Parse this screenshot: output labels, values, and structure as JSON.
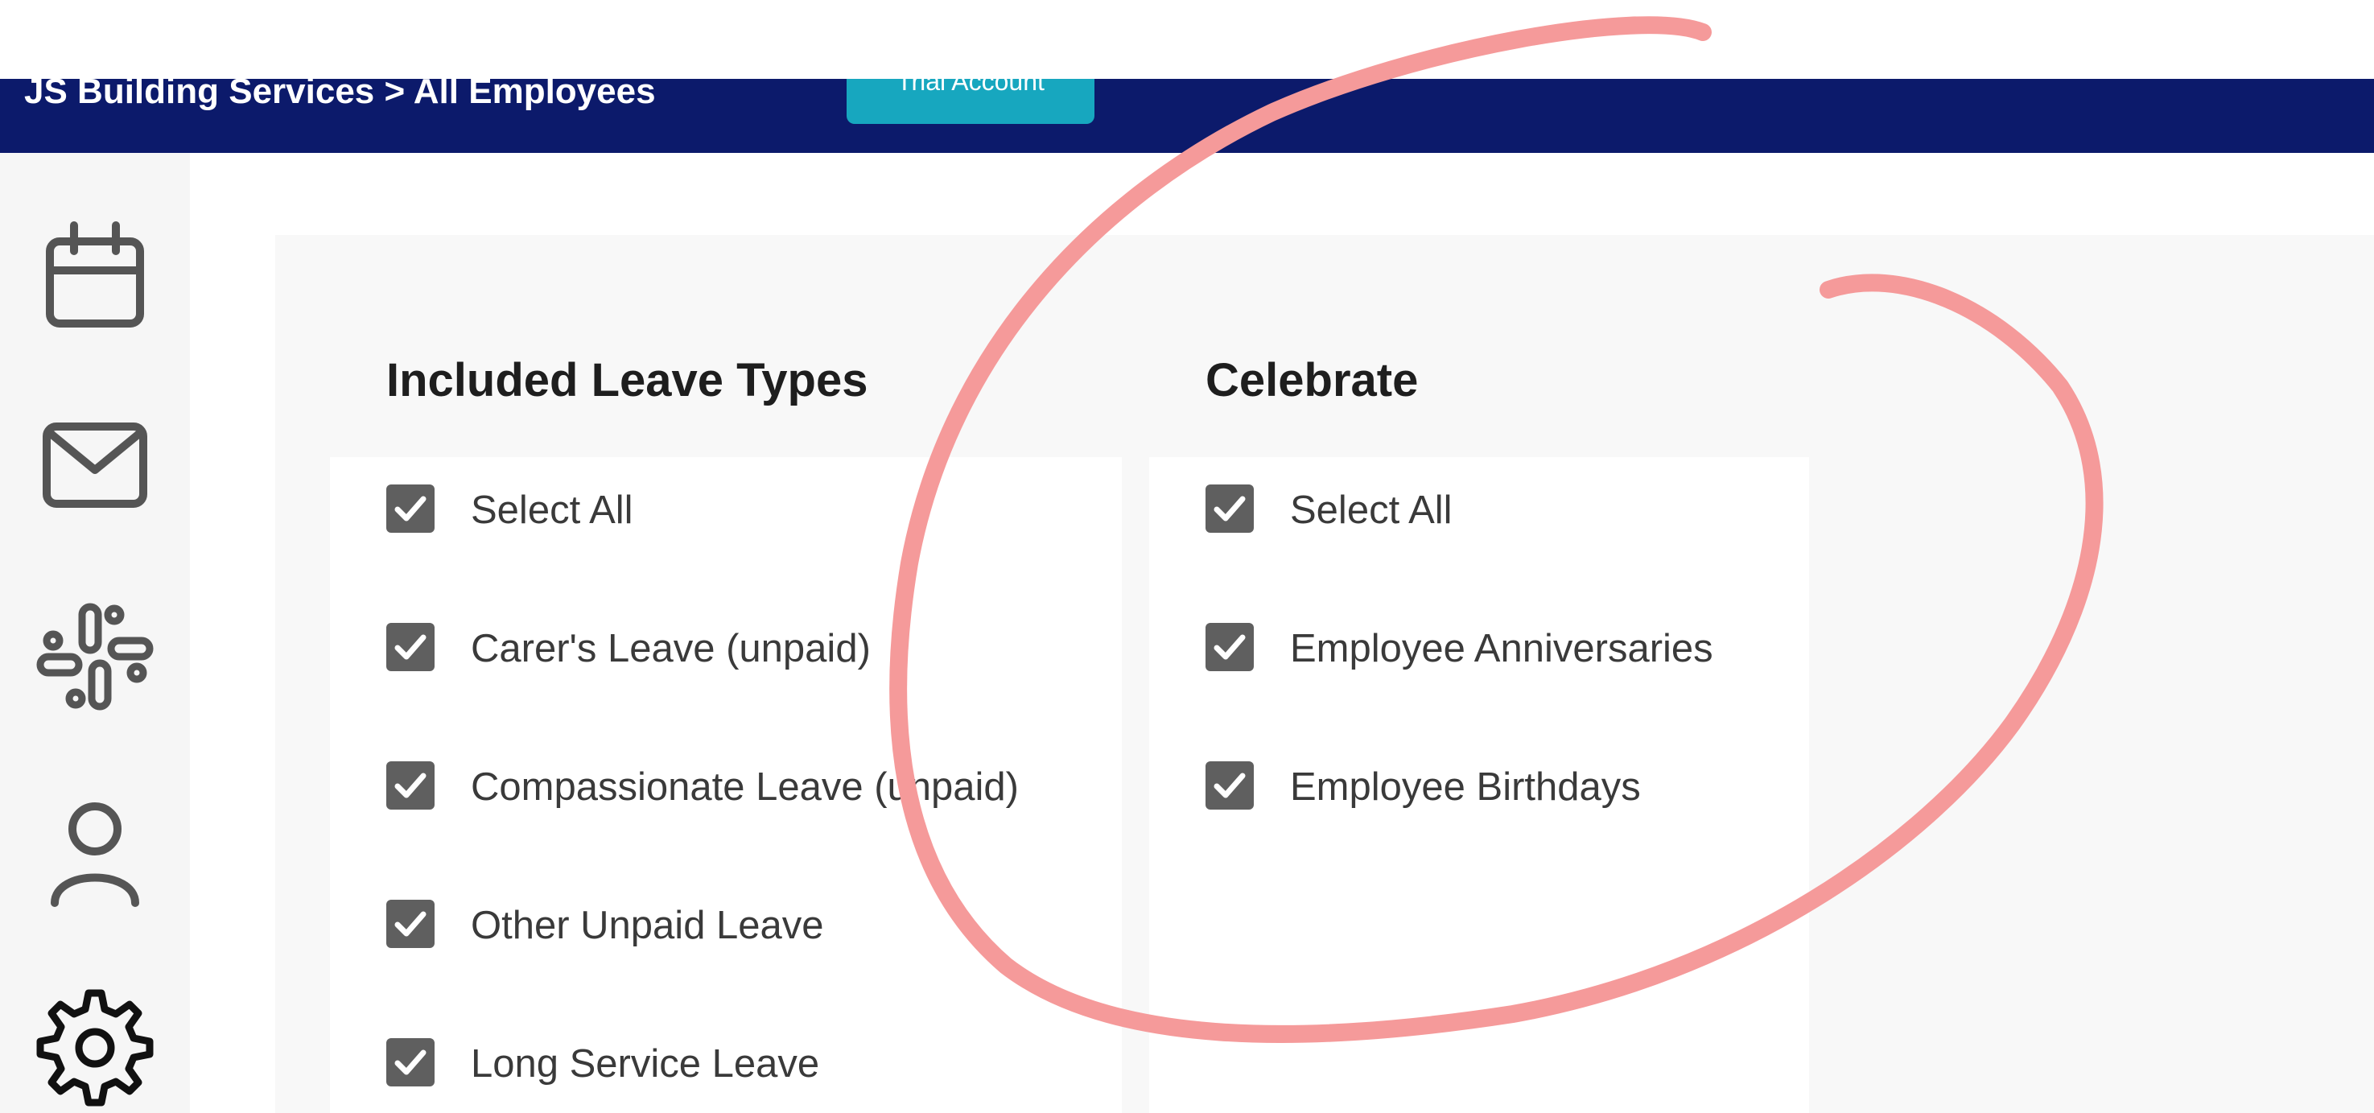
{
  "header": {
    "breadcrumb": "JS Building Services > All Employees",
    "trial_badge": "Trial Account"
  },
  "sidebar": {
    "items": [
      {
        "icon": "calendar-icon"
      },
      {
        "icon": "mail-icon"
      },
      {
        "icon": "slack-icon"
      },
      {
        "icon": "user-icon"
      },
      {
        "icon": "gear-icon"
      }
    ]
  },
  "leave_types": {
    "title": "Included Leave Types",
    "options": [
      {
        "label": "Select All",
        "checked": true
      },
      {
        "label": "Carer's Leave (unpaid)",
        "checked": true
      },
      {
        "label": "Compassionate Leave (unpaid)",
        "checked": true
      },
      {
        "label": "Other Unpaid Leave",
        "checked": true
      },
      {
        "label": "Long Service Leave",
        "checked": true
      }
    ]
  },
  "celebrate": {
    "title": "Celebrate",
    "options": [
      {
        "label": "Select All",
        "checked": true
      },
      {
        "label": "Employee Anniversaries",
        "checked": true
      },
      {
        "label": "Employee Birthdays",
        "checked": true
      }
    ]
  },
  "colors": {
    "header_bg": "#0c1a6b",
    "badge_bg": "#17a7bf",
    "checkbox": "#5f5f5f",
    "annotation": "#f59a9a"
  }
}
